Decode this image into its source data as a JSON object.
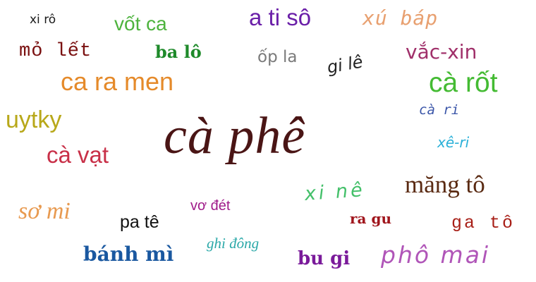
{
  "words": [
    {
      "text": "xi rô",
      "color": "#1a1a1a"
    },
    {
      "text": "vốt ca",
      "color": "#4db33d"
    },
    {
      "text": "a ti sô",
      "color": "#6a1fa8"
    },
    {
      "text": "xú báp",
      "color": "#e8a070"
    },
    {
      "text": "mỏ lết",
      "color": "#7a1010"
    },
    {
      "text": "ba lô",
      "color": "#1e8a2a"
    },
    {
      "text": "ốp la",
      "color": "#7a7a7a"
    },
    {
      "text": "gi lê",
      "color": "#222222"
    },
    {
      "text": "vắc-xin",
      "color": "#a0306a"
    },
    {
      "text": "ca ra men",
      "color": "#e58a2a"
    },
    {
      "text": "cà rốt",
      "color": "#44bb33"
    },
    {
      "text": "cà ri",
      "color": "#3a55a8"
    },
    {
      "text": "uytky",
      "color": "#b8a81a"
    },
    {
      "text": "cà phê",
      "color": "#4a1515"
    },
    {
      "text": "xê-ri",
      "color": "#2ab0d8"
    },
    {
      "text": "cà vạt",
      "color": "#c83048"
    },
    {
      "text": "măng tô",
      "color": "#5a2a12"
    },
    {
      "text": "xi nê",
      "color": "#44c06a"
    },
    {
      "text": "vơ đét",
      "color": "#a01c8a"
    },
    {
      "text": "sơ mi",
      "color": "#e89a50"
    },
    {
      "text": "ra gu",
      "color": "#a0151c"
    },
    {
      "text": "pa tê",
      "color": "#111111"
    },
    {
      "text": "ga tô",
      "color": "#a82018"
    },
    {
      "text": "ghi đông",
      "color": "#2aa8a8"
    },
    {
      "text": "bánh mì",
      "color": "#1a58a0"
    },
    {
      "text": "phô mai",
      "color": "#b055b8"
    },
    {
      "text": "bu gi",
      "color": "#7a1a9a"
    }
  ]
}
